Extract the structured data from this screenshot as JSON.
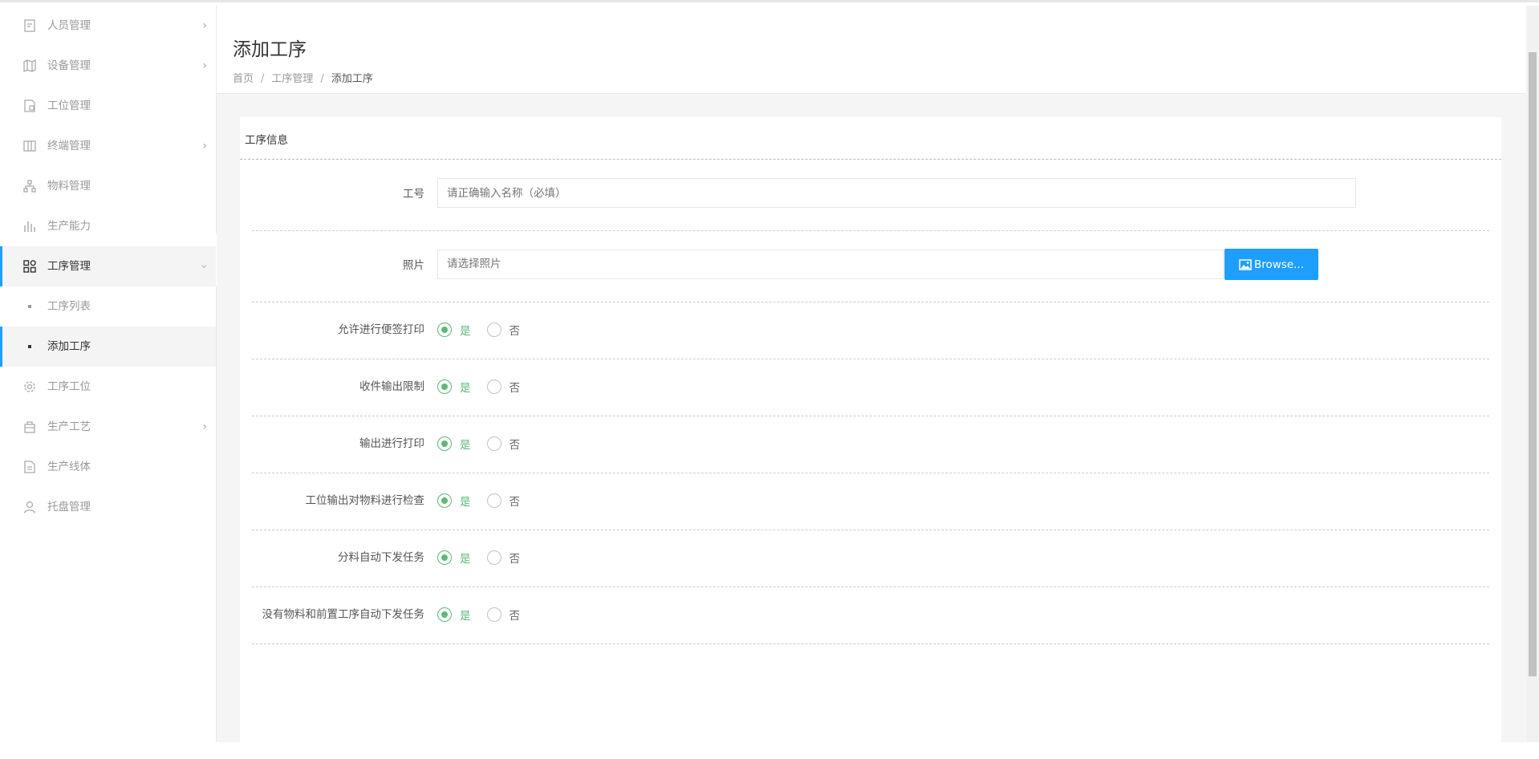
{
  "sidebar": {
    "items": [
      {
        "label": "人员管理",
        "icon": "document-icon",
        "has_children": true
      },
      {
        "label": "设备管理",
        "icon": "map-icon",
        "has_children": true
      },
      {
        "label": "工位管理",
        "icon": "station-file-icon",
        "has_children": false
      },
      {
        "label": "终端管理",
        "icon": "columns-icon",
        "has_children": true
      },
      {
        "label": "物料管理",
        "icon": "hierarchy-icon",
        "has_children": false
      },
      {
        "label": "生产能力",
        "icon": "bar-chart-icon",
        "has_children": false
      }
    ],
    "open_group": {
      "label": "工序管理",
      "icon": "apps-grid-icon",
      "children": [
        {
          "label": "工序列表",
          "active": false
        },
        {
          "label": "添加工序",
          "active": true
        }
      ]
    },
    "items_after": [
      {
        "label": "工序工位",
        "icon": "gear-icon",
        "has_children": false
      },
      {
        "label": "生产工艺",
        "icon": "bag-icon",
        "has_children": true
      },
      {
        "label": "生产线体",
        "icon": "file-icon",
        "has_children": false
      },
      {
        "label": "托盘管理",
        "icon": "user-icon",
        "has_children": false
      }
    ]
  },
  "header": {
    "title": "添加工序",
    "breadcrumb": [
      "首页",
      "工序管理",
      "添加工序"
    ]
  },
  "form": {
    "section_title": "工序信息",
    "name_label": "工号",
    "name_placeholder": "请正确输入名称（必填）",
    "photo_label": "照片",
    "photo_placeholder": "请选择照片",
    "browse_label": "Browse...",
    "yes_label": "是",
    "no_label": "否",
    "options": [
      {
        "label": "允许进行便签打印",
        "value": "是"
      },
      {
        "label": "收件输出限制",
        "value": "是"
      },
      {
        "label": "输出进行打印",
        "value": "是"
      },
      {
        "label": "工位输出对物料进行检查",
        "value": "是"
      },
      {
        "label": "分料自动下发任务",
        "value": "是"
      },
      {
        "label": "没有物料和前置工序自动下发任务",
        "value": "是"
      }
    ]
  },
  "colors": {
    "accent_blue": "#1e9fff",
    "radio_green": "#5fb878"
  }
}
